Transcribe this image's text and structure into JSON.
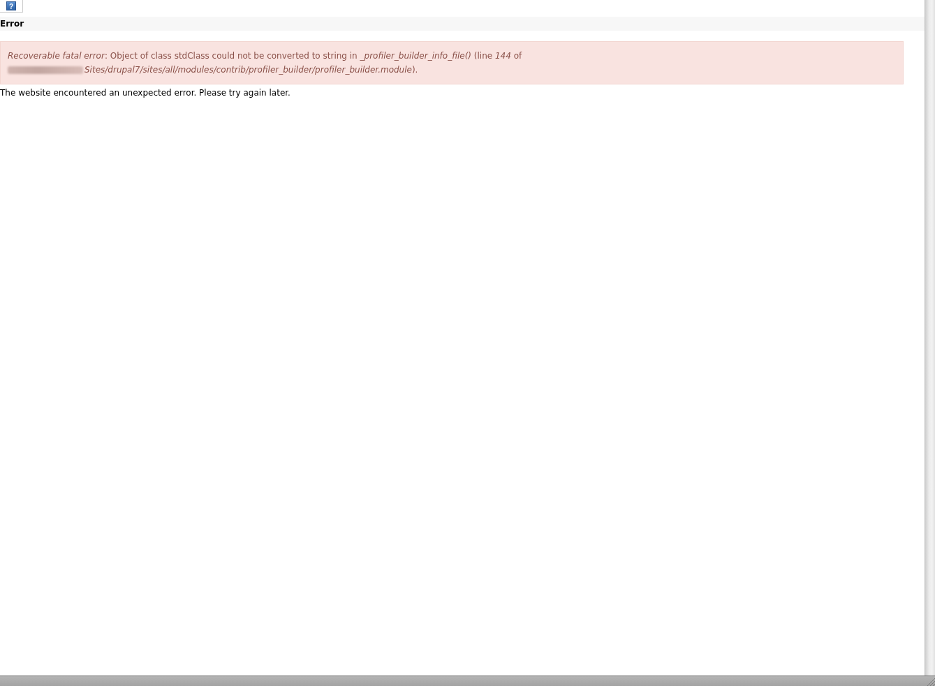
{
  "toolbar": {
    "help_glyph": "?"
  },
  "page_title": "Error",
  "error_message": {
    "lines": [
      {
        "text": "*Recoverable fatal error*: Object of class stdClass could not be converted to string in *_profiler_builder_info_file()* (line *144* of",
        "redacted_prefix": false
      },
      {
        "text": "*Sites/drupal7/sites/all/modules/contrib/profiler_builder/profiler_builder.module*).",
        "redacted_prefix": true
      }
    ]
  },
  "body_text": "The website encountered an unexpected error. Please try again later."
}
